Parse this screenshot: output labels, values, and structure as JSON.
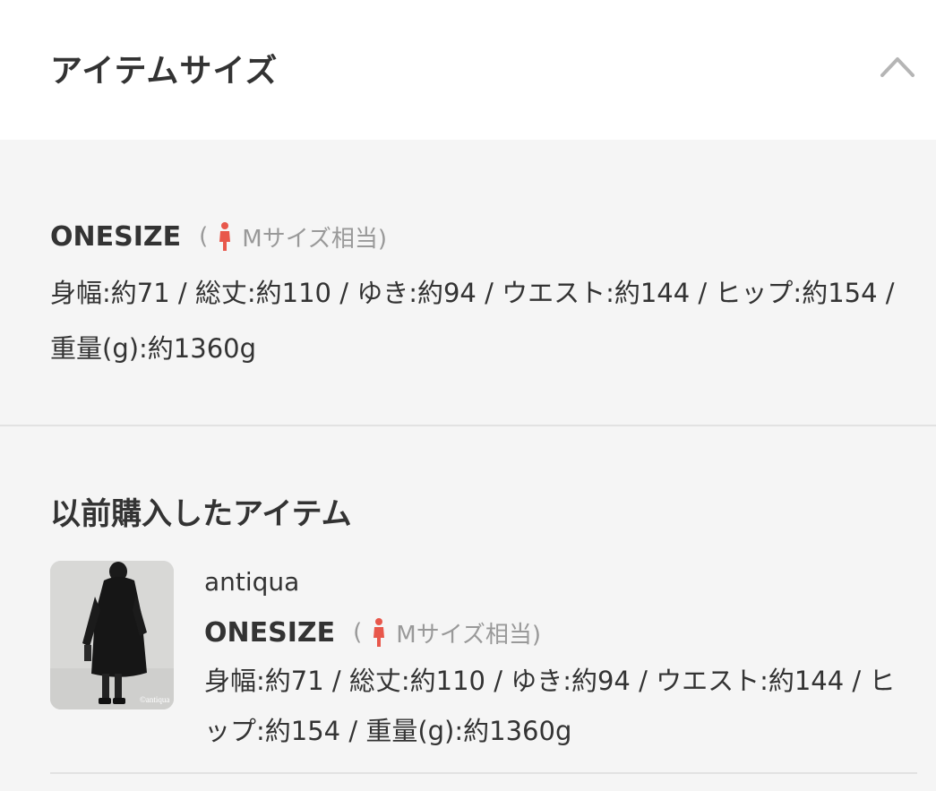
{
  "header": {
    "title": "アイテムサイズ",
    "collapse_icon": "chevron-up-icon"
  },
  "size": {
    "name": "ONESIZE",
    "equiv_open": "(",
    "equiv_text": "Mサイズ相当)",
    "person_icon": "person-icon",
    "person_icon_color": "#e8574b",
    "dimensions": "身幅:約71 / 総丈:約110 / ゆき:約94 / ウエスト:約144 / ヒップ:約154 / 重量(g):約1360g"
  },
  "previous": {
    "title": "以前購入したアイテム",
    "item": {
      "brand": "antiqua",
      "size_name": "ONESIZE",
      "equiv_open": "(",
      "equiv_text": "Mサイズ相当)",
      "dimensions": "身幅:約71 / 総丈:約110 / ゆき:約94 / ウエスト:約144 / ヒップ:約154 / 重量(g):約1360g",
      "thumbnail_watermark": "©antiqua"
    }
  }
}
